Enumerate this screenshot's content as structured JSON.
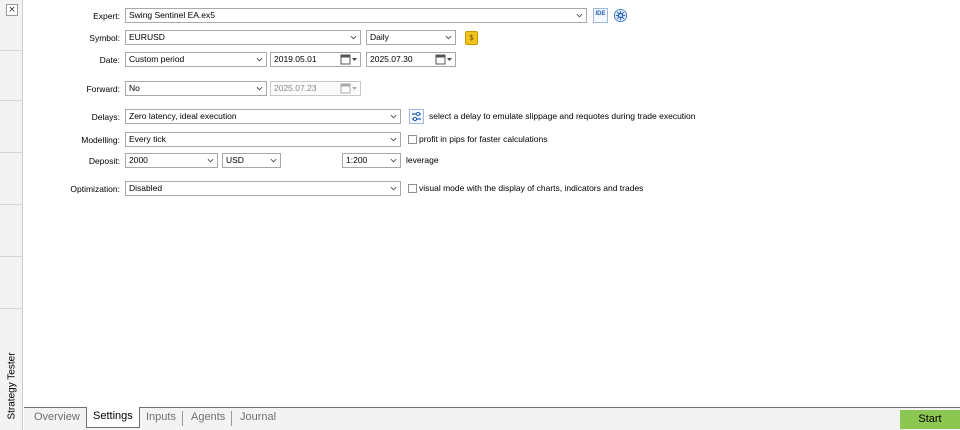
{
  "panel": {
    "vertical_title": "Strategy Tester",
    "close_glyph": "×"
  },
  "form": {
    "expert": {
      "label": "Expert:",
      "value": "Swing Sentinel EA.ex5",
      "ide_label": "IDE",
      "settings_icon": "gear-icon"
    },
    "symbol": {
      "label": "Symbol:",
      "value": "EURUSD",
      "period": "Daily",
      "spec_icon": "dollar-icon"
    },
    "date": {
      "label": "Date:",
      "value": "Custom period",
      "from": "2019.05.01",
      "to": "2025.07.30"
    },
    "forward": {
      "label": "Forward:",
      "value": "No",
      "date": "2025.07.23"
    },
    "delays": {
      "label": "Delays:",
      "value": "Zero latency, ideal execution",
      "note": "select a delay to emulate slippage and requotes during trade execution",
      "delay_icon": "sliders-icon"
    },
    "modelling": {
      "label": "Modelling:",
      "value": "Every tick",
      "checkbox_label": "profit in pips for faster calculations",
      "checked": false
    },
    "deposit": {
      "label": "Deposit:",
      "value": "2000",
      "currency": "USD",
      "leverage": "1:200",
      "leverage_label": "leverage"
    },
    "optimization": {
      "label": "Optimization:",
      "value": "Disabled",
      "checkbox_label": "visual mode with the display of charts, indicators and trades",
      "checked": false
    }
  },
  "tabs": [
    "Overview",
    "Settings",
    "Inputs",
    "Agents",
    "Journal"
  ],
  "active_tab": "Settings",
  "start_label": "Start",
  "colors": {
    "start_bg": "#8cc751",
    "ide_blue": "#1f5fb4",
    "spec_yellow": "#f2c31c"
  }
}
